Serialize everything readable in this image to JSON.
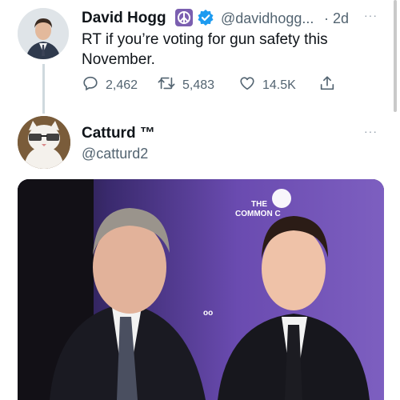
{
  "tweet1": {
    "name": "David Hogg",
    "handle": "@davidhogg...",
    "time": "· 2d",
    "text_line1": "RT if you’re voting for gun safety this",
    "text_line2": "November.",
    "reply_count": "2,462",
    "retweet_count": "5,483",
    "like_count": "14.5K",
    "more": "···"
  },
  "tweet2": {
    "name": "Catturd ™",
    "handle": "@catturd2",
    "more": "···"
  },
  "photo": {
    "backdrop_line1": "THE",
    "backdrop_line2": "COMMON C",
    "backdrop_fragment": "oo"
  },
  "colors": {
    "verified": "#1d9bf0",
    "peace_badge": "#7b5fb0",
    "muted": "#536471"
  },
  "icons": [
    "peace-icon",
    "verified-badge-icon",
    "reply-icon",
    "retweet-icon",
    "like-icon",
    "share-icon",
    "more-icon"
  ]
}
